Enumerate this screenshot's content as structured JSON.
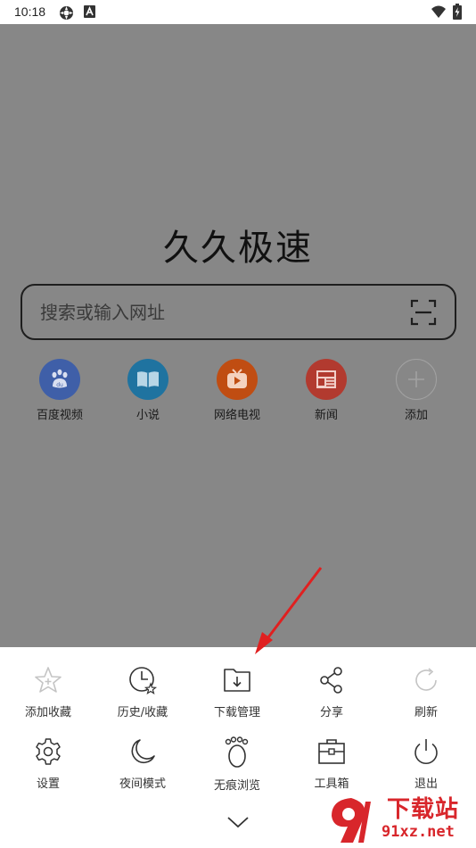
{
  "status_bar": {
    "time": "10:18"
  },
  "home": {
    "title": "久久极速",
    "search_placeholder": "搜索或输入网址",
    "shortcuts": [
      {
        "label": "百度视频",
        "color": "#3f5fa8"
      },
      {
        "label": "小说",
        "color": "#1f73a0"
      },
      {
        "label": "网络电视",
        "color": "#c04d12"
      },
      {
        "label": "新闻",
        "color": "#b23a2f"
      },
      {
        "label": "添加",
        "color": "#9a9a9a"
      }
    ]
  },
  "menu": {
    "row1": [
      {
        "label": "添加收藏",
        "icon": "star-add-icon"
      },
      {
        "label": "历史/收藏",
        "icon": "history-icon"
      },
      {
        "label": "下载管理",
        "icon": "download-folder-icon"
      },
      {
        "label": "分享",
        "icon": "share-icon"
      },
      {
        "label": "刷新",
        "icon": "refresh-icon"
      }
    ],
    "row2": [
      {
        "label": "设置",
        "icon": "gear-icon"
      },
      {
        "label": "夜间模式",
        "icon": "moon-icon"
      },
      {
        "label": "无痕浏览",
        "icon": "footprint-icon"
      },
      {
        "label": "工具箱",
        "icon": "toolbox-icon"
      },
      {
        "label": "退出",
        "icon": "power-icon"
      }
    ]
  },
  "watermark": {
    "line1": "下载站",
    "line2": "91xz.net"
  }
}
